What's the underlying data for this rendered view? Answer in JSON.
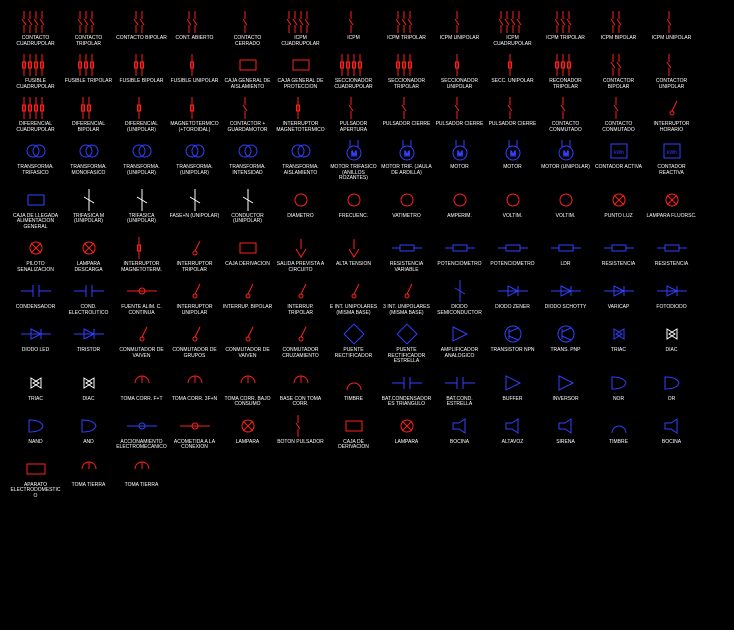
{
  "symbols": [
    {
      "id": "contacto-cuadrupolar",
      "label": "Contacto Cuadrupolar",
      "c": "r"
    },
    {
      "id": "contacto-tripolar",
      "label": "Contacto Tripolar",
      "c": "r"
    },
    {
      "id": "contacto-bipolar",
      "label": "Contacto Bipolar",
      "c": "r"
    },
    {
      "id": "cont-abierto",
      "label": "Cont. Abierto",
      "c": "r"
    },
    {
      "id": "contacto-cerrado",
      "label": "Contacto Cerrado",
      "c": "r"
    },
    {
      "id": "icpm-cuadrupolar",
      "label": "ICPM Cuadrupolar",
      "c": "r"
    },
    {
      "id": "icpm-1",
      "label": "ICPM",
      "c": "r"
    },
    {
      "id": "icpm-tripolar",
      "label": "ICPM Tripolar",
      "c": "r"
    },
    {
      "id": "icpm-unipolar",
      "label": "ICPM Unipolar",
      "c": "r"
    },
    {
      "id": "icpm-cuadrupolar-2",
      "label": "ICPM Cuadrupolar",
      "c": "r"
    },
    {
      "id": "icpm-tripolar-2",
      "label": "ICPM Tripolar",
      "c": "r"
    },
    {
      "id": "icpm-bipolar",
      "label": "ICPM Bipolar",
      "c": "r"
    },
    {
      "id": "icpm-unipolar-2",
      "label": "ICPM Unipolar",
      "c": "r"
    },
    {
      "id": "fusible-cuadrupolar",
      "label": "Fusible Cuadrupolar",
      "c": "r"
    },
    {
      "id": "fusible-tripolar",
      "label": "Fusible Tripolar",
      "c": "r"
    },
    {
      "id": "fusible-bipolar",
      "label": "Fusible Bipolar",
      "c": "r"
    },
    {
      "id": "fusible-unipolar",
      "label": "Fusible Unipolar",
      "c": "r"
    },
    {
      "id": "caja-general-aislamiento",
      "label": "Caja General de Aislamiento",
      "c": "r"
    },
    {
      "id": "caja-general-proteccion",
      "label": "Caja General de Proteccion",
      "c": "r"
    },
    {
      "id": "seccionador-cuadrupolar",
      "label": "Seccionador Cuadrupolar",
      "c": "r"
    },
    {
      "id": "seccionador-tripolar",
      "label": "Seccionador Tripolar",
      "c": "r"
    },
    {
      "id": "seccionador-unipolar",
      "label": "Seccionador Unipolar",
      "c": "r"
    },
    {
      "id": "secc-unipolar",
      "label": "Secc. Unipolar",
      "c": "r"
    },
    {
      "id": "reconador-tripolar",
      "label": "Reconador Tripolar",
      "c": "r"
    },
    {
      "id": "contactor-bipolar",
      "label": "Contactor Bipolar",
      "c": "r"
    },
    {
      "id": "contactor-unipolar",
      "label": "Contactor Unipolar",
      "c": "r"
    },
    {
      "id": "diferencial-cuadrupolar",
      "label": "Diferencial Cuadrupolar",
      "c": "r"
    },
    {
      "id": "diferencial-bipolar",
      "label": "Diferencial Bipolar",
      "c": "r"
    },
    {
      "id": "diferencial-unipolar",
      "label": "Diferencial (Unipolar)",
      "c": "r"
    },
    {
      "id": "magnetotermico-toroidal",
      "label": "Magnetotermico (+Toroidal)",
      "c": "r"
    },
    {
      "id": "contactor-guardamotor",
      "label": "Contactor + Guardamotor",
      "c": "r"
    },
    {
      "id": "interruptor-magnetotermico",
      "label": "Interruptor Magnetotermico",
      "c": "r"
    },
    {
      "id": "pulsador-apertura",
      "label": "Pulsador Apertura",
      "c": "r"
    },
    {
      "id": "pulsador-cierre",
      "label": "Pulsador Cierre",
      "c": "r"
    },
    {
      "id": "pulsador-cierre-2",
      "label": "Pulsador Cierre",
      "c": "r"
    },
    {
      "id": "pulsador-cierre-3",
      "label": "Pulsador Cierre",
      "c": "r"
    },
    {
      "id": "contacto-conmutado",
      "label": "Contacto Conmutado",
      "c": "r"
    },
    {
      "id": "contacto-conmutado-2",
      "label": "Contacto Conmutado",
      "c": "r"
    },
    {
      "id": "interruptor-horario",
      "label": "Interruptor Horario",
      "c": "r"
    },
    {
      "id": "transforma-trifasico",
      "label": "Transforma. Trifasico",
      "c": "b"
    },
    {
      "id": "transforma-monofasico",
      "label": "Transforma. Monofasico",
      "c": "b"
    },
    {
      "id": "transforma-unipolar",
      "label": "Transforma. (Unipolar)",
      "c": "b"
    },
    {
      "id": "transforma-unipolar-2",
      "label": "Transforma. (Unipolar)",
      "c": "b"
    },
    {
      "id": "transforma-intensidad",
      "label": "Transforma. Intensidad",
      "c": "b"
    },
    {
      "id": "transforma-aislamiento",
      "label": "Transforma. Aislamiento",
      "c": "b"
    },
    {
      "id": "motor-trifasico-anillos",
      "label": "Motor Trifasico (Anillos Rozantes)",
      "c": "b"
    },
    {
      "id": "motor-trif-jaula",
      "label": "Motor Trif. (Jaula de Ardilla)",
      "c": "b"
    },
    {
      "id": "motor",
      "label": "Motor",
      "c": "b"
    },
    {
      "id": "motor-2",
      "label": "Motor",
      "c": "b"
    },
    {
      "id": "motor-unipolar",
      "label": "Motor (Unipolar)",
      "c": "b"
    },
    {
      "id": "contador-activa",
      "label": "Contador Activa",
      "c": "b"
    },
    {
      "id": "contador-reactiva",
      "label": "Contador Reactiva",
      "c": "b"
    },
    {
      "id": "caja-llegada",
      "label": "Caja de Llegada Alimentacion General",
      "c": "b"
    },
    {
      "id": "trifasica-m-unipolar",
      "label": "Trifasica M (Unipolar)",
      "c": "w"
    },
    {
      "id": "trifasica-unipolar",
      "label": "Trifasica (Unipolar)",
      "c": "w"
    },
    {
      "id": "fase-n-unipolar",
      "label": "Fase+N (Unipolar)",
      "c": "w"
    },
    {
      "id": "conductor-unipolar",
      "label": "Conductor (Unipolar)",
      "c": "w"
    },
    {
      "id": "diametro",
      "label": "Diametro",
      "c": "r"
    },
    {
      "id": "frecuencimetro",
      "label": "Frecuenc.",
      "c": "r"
    },
    {
      "id": "vatimetro",
      "label": "Vatimetro",
      "c": "r"
    },
    {
      "id": "amperim",
      "label": "Amperim.",
      "c": "r"
    },
    {
      "id": "voltim",
      "label": "Voltim.",
      "c": "r"
    },
    {
      "id": "voltim-2",
      "label": "Voltim.",
      "c": "r"
    },
    {
      "id": "punto-luz",
      "label": "Punto Luz",
      "c": "r"
    },
    {
      "id": "lampara-fluorsc",
      "label": "Lampara Fluorsc.",
      "c": "r"
    },
    {
      "id": "piloto-senalizacion",
      "label": "Piloto Senalizacion",
      "c": "r"
    },
    {
      "id": "lampara-descarga",
      "label": "Lampara Descarga",
      "c": "r"
    },
    {
      "id": "interruptor-magnetoterm",
      "label": "Interruptor Magnetoterm.",
      "c": "r"
    },
    {
      "id": "interruptor-tripolar",
      "label": "Interruptor Tripolar",
      "c": "r"
    },
    {
      "id": "caja-derivacion",
      "label": "Caja Derivacion",
      "c": "r"
    },
    {
      "id": "salida-prevista-circuito",
      "label": "Salida Prevista a Circuito",
      "c": "r"
    },
    {
      "id": "alta-tension",
      "label": "Alta Tension",
      "c": "r"
    },
    {
      "id": "resistencia-variable",
      "label": "Resistencia Variable",
      "c": "b"
    },
    {
      "id": "potenciometro",
      "label": "Potenciometro",
      "c": "b"
    },
    {
      "id": "potenciometro-2",
      "label": "Potenciometro",
      "c": "b"
    },
    {
      "id": "ldr",
      "label": "LDR",
      "c": "b"
    },
    {
      "id": "resistencia",
      "label": "Resistencia",
      "c": "b"
    },
    {
      "id": "resistencia-2",
      "label": "Resistencia",
      "c": "b"
    },
    {
      "id": "condensador",
      "label": "Condensador",
      "c": "b"
    },
    {
      "id": "cond-electrolitico",
      "label": "Cond. Electrolitico",
      "c": "b"
    },
    {
      "id": "fuente-alim-continua",
      "label": "Fuente Alim. C. Continua",
      "c": "r"
    },
    {
      "id": "interruptor-unipolar",
      "label": "Interruptor Unipolar",
      "c": "r"
    },
    {
      "id": "interrup-bipolar",
      "label": "Interrup. Bipolar",
      "c": "r"
    },
    {
      "id": "interrup-tripolar",
      "label": "Interrup. Tripolar",
      "c": "r"
    },
    {
      "id": "e-int-unipolares-1",
      "label": "E Int. Unipolares (Misma Base)",
      "c": "r"
    },
    {
      "id": "e-int-unipolares-2",
      "label": "3 Int. Unipolares (Misma Base)",
      "c": "r"
    },
    {
      "id": "diodo-semiconductor",
      "label": "Diodo Semiconductor",
      "c": "b"
    },
    {
      "id": "diodo-zener",
      "label": "Diodo Zener",
      "c": "b"
    },
    {
      "id": "diodo-schotty",
      "label": "Diodo Schotty",
      "c": "b"
    },
    {
      "id": "varicap",
      "label": "Varicap",
      "c": "b"
    },
    {
      "id": "fotodiodo",
      "label": "Fotodiodo",
      "c": "b"
    },
    {
      "id": "diodo-led",
      "label": "Diodo LED",
      "c": "b"
    },
    {
      "id": "tiristor",
      "label": "Tiristor",
      "c": "b"
    },
    {
      "id": "conmutador-vaiven",
      "label": "Conmutador de Vaiven",
      "c": "r"
    },
    {
      "id": "conmutador-grupos",
      "label": "Conmutador de Grupos",
      "c": "r"
    },
    {
      "id": "conmutador-vaiven-2",
      "label": "Conmutador de Vaiven",
      "c": "r"
    },
    {
      "id": "conmutador-cruzamiento",
      "label": "Conmutador Cruzamiento",
      "c": "r"
    },
    {
      "id": "puente-rectificador",
      "label": "Puente Rectificador",
      "c": "b"
    },
    {
      "id": "puente-rectificador-estrella",
      "label": "Puente Rectificador Estrella",
      "c": "b"
    },
    {
      "id": "amplificador-analogico",
      "label": "Amplificador Analogico",
      "c": "b"
    },
    {
      "id": "transistor-npn",
      "label": "Transistor NPN",
      "c": "b"
    },
    {
      "id": "trans-pnp",
      "label": "Trans. PNP",
      "c": "b"
    },
    {
      "id": "triac",
      "label": "Triac",
      "c": "b"
    },
    {
      "id": "diac",
      "label": "Diac",
      "c": "w"
    },
    {
      "id": "triac-2",
      "label": "Triac",
      "c": "w"
    },
    {
      "id": "diac-2",
      "label": "Diac",
      "c": "w"
    },
    {
      "id": "toma-corr-ft",
      "label": "Toma Corr. F+T",
      "c": "r"
    },
    {
      "id": "toma-corr-3ft",
      "label": "Toma Corr. 3F+N",
      "c": "r"
    },
    {
      "id": "toma-corr-bajo-consumo",
      "label": "Toma Corr. Bajo Consumo",
      "c": "r"
    },
    {
      "id": "base-con-toma-corr",
      "label": "Base con Toma Corr.",
      "c": "r"
    },
    {
      "id": "timbre",
      "label": "Timbre",
      "c": "r"
    },
    {
      "id": "bat-condensadores-triangulo",
      "label": "Bat.Condensadores Triangulo",
      "c": "b"
    },
    {
      "id": "bat-cond-estrella",
      "label": "Bat.Cond. Estrella",
      "c": "b"
    },
    {
      "id": "buffer",
      "label": "Buffer",
      "c": "b"
    },
    {
      "id": "inversor",
      "label": "Inversor",
      "c": "b"
    },
    {
      "id": "nor",
      "label": "NOR",
      "c": "b"
    },
    {
      "id": "or",
      "label": "OR",
      "c": "b"
    },
    {
      "id": "nand",
      "label": "NAND",
      "c": "b"
    },
    {
      "id": "and",
      "label": "AND",
      "c": "b"
    },
    {
      "id": "accionamiento-electromecanico",
      "label": "Accionamiento Electromecanico",
      "c": "b"
    },
    {
      "id": "acometida-conexion",
      "label": "Acometida a la Conexion",
      "c": "r"
    },
    {
      "id": "lampara",
      "label": "Lampara",
      "c": "r"
    },
    {
      "id": "boton-pulsador",
      "label": "Boton Pulsador",
      "c": "r"
    },
    {
      "id": "caja-derivacion-2",
      "label": "Caja de Derivacion",
      "c": "r"
    },
    {
      "id": "lampara-2",
      "label": "Lampara",
      "c": "r"
    },
    {
      "id": "bocina",
      "label": "Bocina",
      "c": "b"
    },
    {
      "id": "altavoz",
      "label": "Altavoz",
      "c": "b"
    },
    {
      "id": "sirena",
      "label": "Sirena",
      "c": "b"
    },
    {
      "id": "timbre-2",
      "label": "Timbre",
      "c": "b"
    },
    {
      "id": "bocina-2",
      "label": "Bocina",
      "c": "b"
    },
    {
      "id": "aparato-electrodomestico",
      "label": "Aparato Electrodomestico",
      "c": "r"
    },
    {
      "id": "toma-tierra",
      "label": "Toma Tierra",
      "c": "r"
    },
    {
      "id": "toma-tierra-2",
      "label": "Toma Tierra",
      "c": "r"
    }
  ]
}
